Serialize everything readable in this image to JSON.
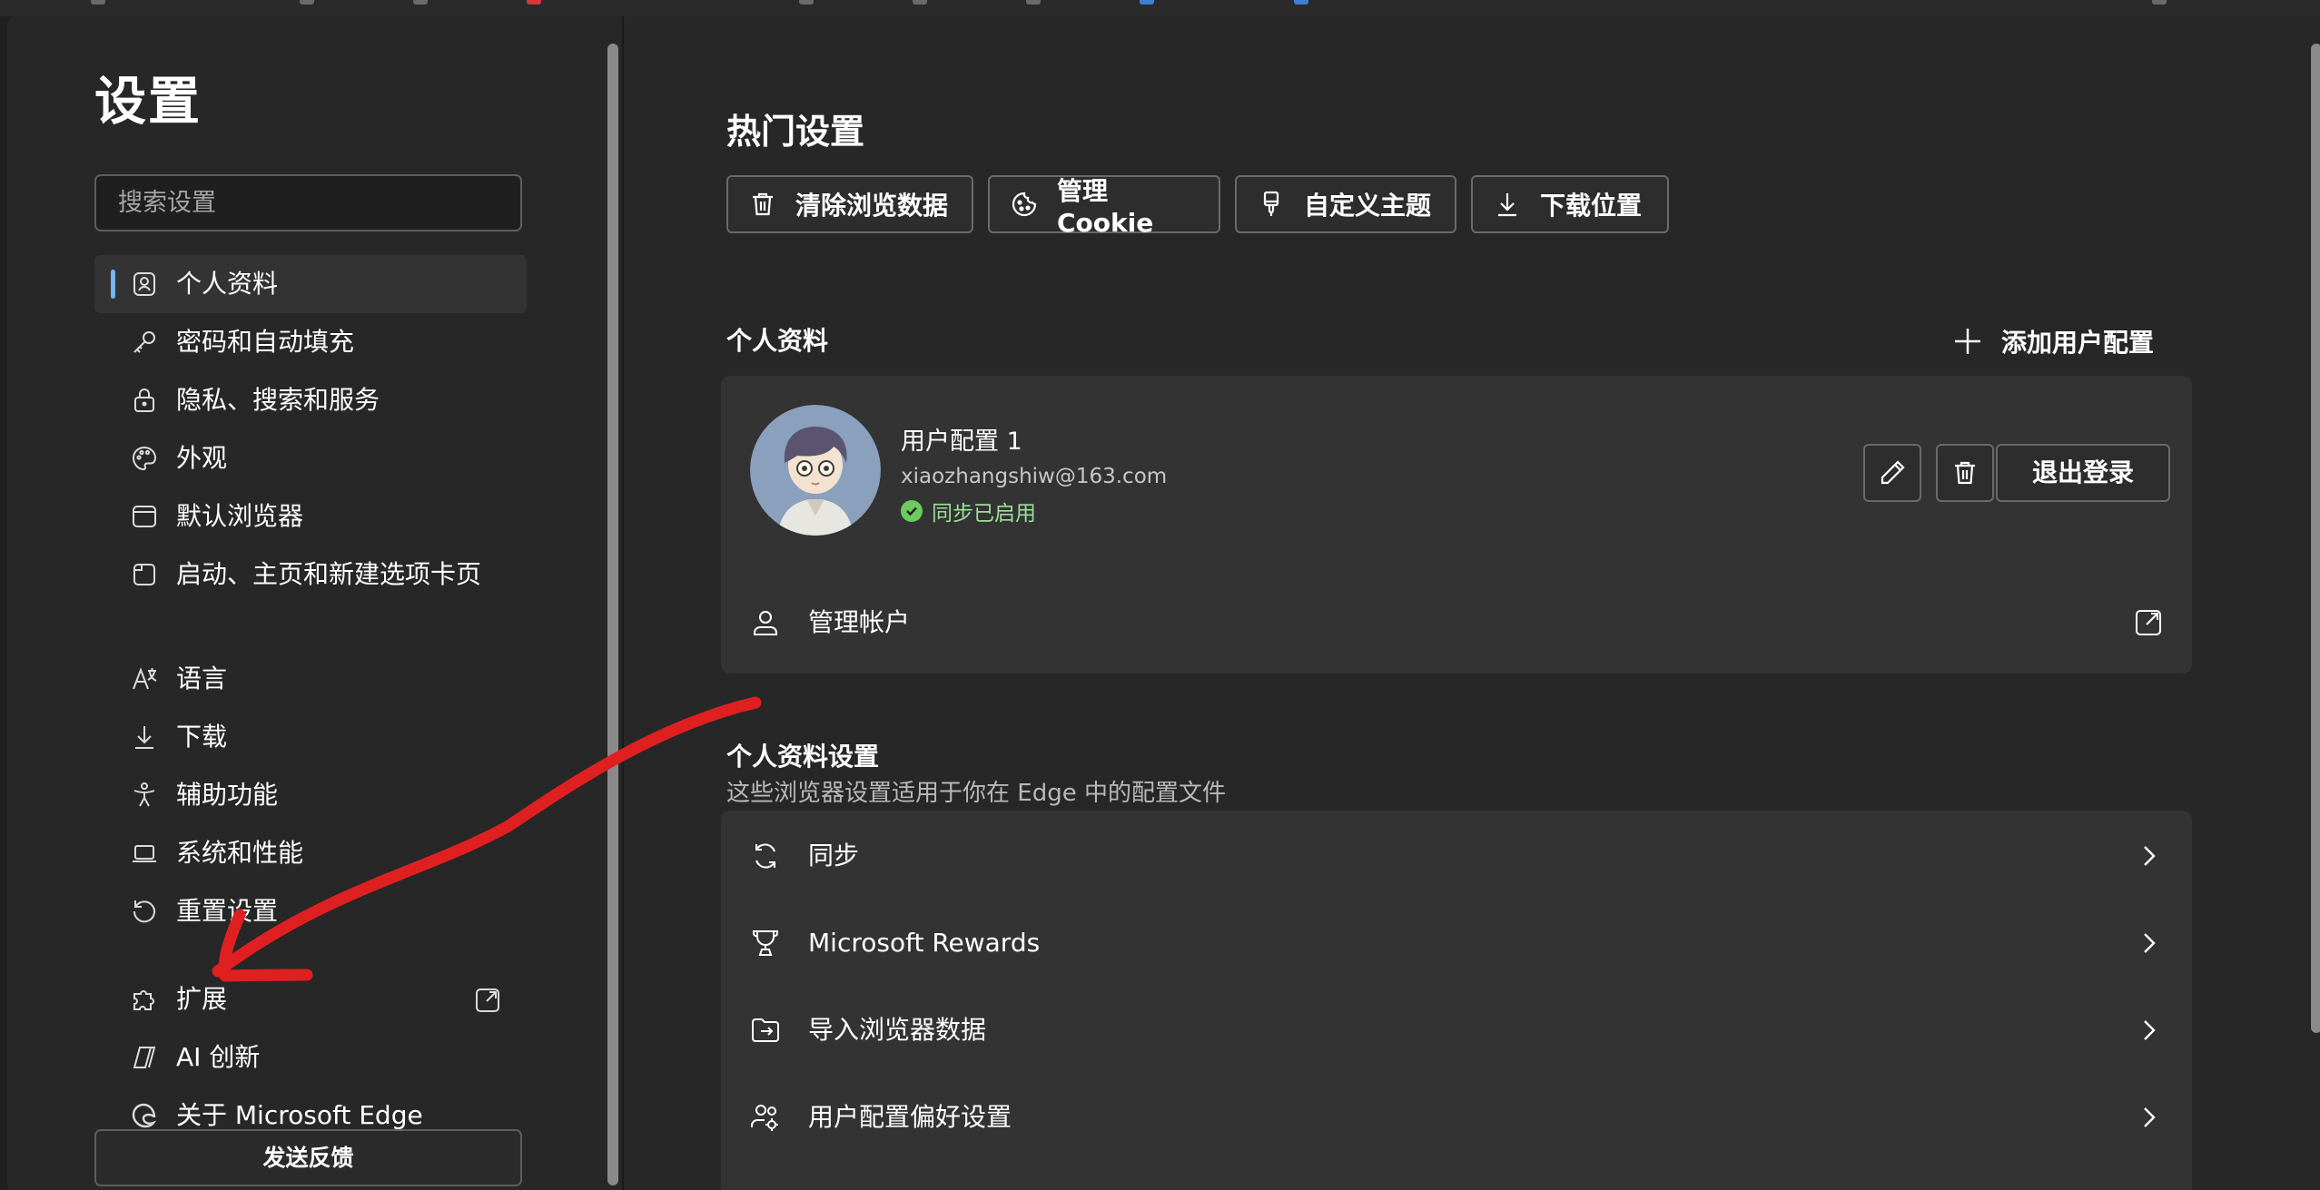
{
  "sidebar": {
    "title": "设置",
    "search_placeholder": "搜索设置",
    "items": [
      {
        "label": "个人资料",
        "icon": "profile-icon",
        "active": true
      },
      {
        "label": "密码和自动填充",
        "icon": "key-icon"
      },
      {
        "label": "隐私、搜索和服务",
        "icon": "lock-icon"
      },
      {
        "label": "外观",
        "icon": "palette-icon"
      },
      {
        "label": "默认浏览器",
        "icon": "browser-window-icon"
      },
      {
        "label": "启动、主页和新建选项卡页",
        "icon": "home-page-icon"
      },
      {
        "label": "语言",
        "icon": "language-icon"
      },
      {
        "label": "下载",
        "icon": "download-icon"
      },
      {
        "label": "辅助功能",
        "icon": "accessibility-icon"
      },
      {
        "label": "系统和性能",
        "icon": "laptop-icon"
      },
      {
        "label": "重置设置",
        "icon": "reset-icon"
      },
      {
        "label": "扩展",
        "icon": "puzzle-icon"
      },
      {
        "label": "AI 创新",
        "icon": "ai-icon"
      },
      {
        "label": "关于 Microsoft Edge",
        "icon": "edge-logo-icon"
      }
    ],
    "feedback_label": "发送反馈"
  },
  "main": {
    "hot_settings_title": "热门设置",
    "quick_buttons": [
      {
        "label": "清除浏览数据",
        "icon": "trash-icon"
      },
      {
        "label": "管理 Cookie",
        "icon": "cookie-icon"
      },
      {
        "label": "自定义主题",
        "icon": "paint-brush-icon"
      },
      {
        "label": "下载位置",
        "icon": "download-icon"
      }
    ],
    "profile_section_title": "个人资料",
    "add_profile_label": "添加用户配置",
    "profile": {
      "name": "用户配置 1",
      "email": "xiaozhangshiw@163.com",
      "sync_status": "同步已启用",
      "signout_label": "退出登录",
      "manage_account_label": "管理帐户"
    },
    "profile_settings_title": "个人资料设置",
    "profile_settings_subtitle": "这些浏览器设置适用于你在 Edge 中的配置文件",
    "settings_rows": [
      {
        "label": "同步",
        "icon": "sync-icon"
      },
      {
        "label": "Microsoft Rewards",
        "icon": "trophy-icon"
      },
      {
        "label": "导入浏览器数据",
        "icon": "import-folder-icon"
      },
      {
        "label": "用户配置偏好设置",
        "icon": "people-settings-icon"
      }
    ]
  },
  "colors": {
    "background": "#272727",
    "card": "#333333",
    "accent": "#74b4f8",
    "sync_green": "#6ccb5f",
    "annotation_red": "#e02020"
  }
}
